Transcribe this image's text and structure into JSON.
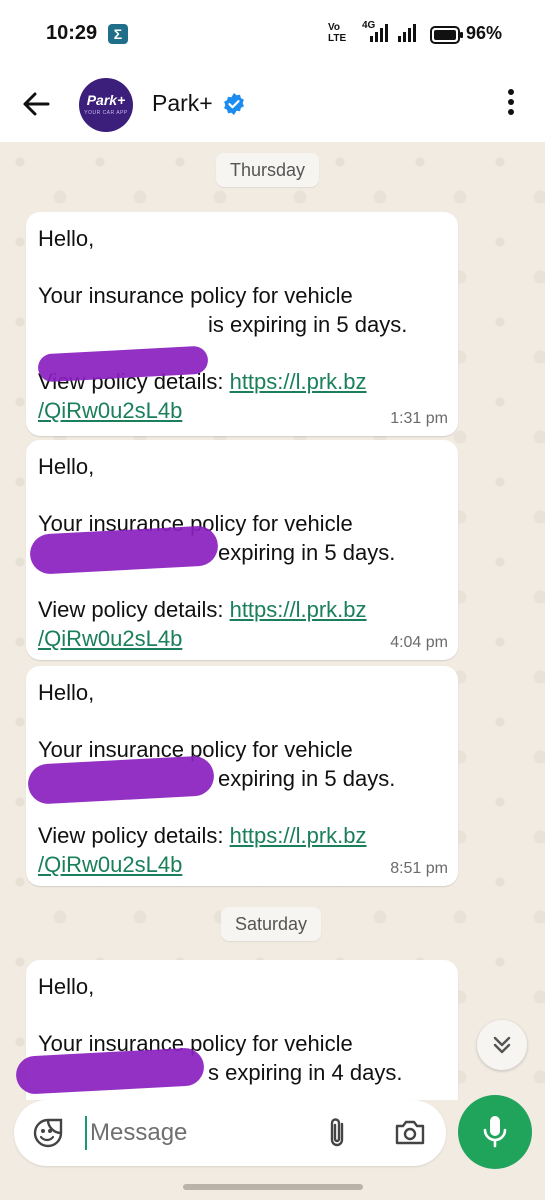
{
  "status_bar": {
    "time": "10:29",
    "app_indicator": "Σ",
    "volte": "Vo\nLTE",
    "network": "4G",
    "battery": "96%"
  },
  "header": {
    "contact_name": "Park+",
    "avatar_logo": "Park+",
    "avatar_sub": "YOUR CAR APP",
    "verified": true
  },
  "chat": {
    "day_1": "Thursday",
    "day_2": "Saturday",
    "messages": [
      {
        "greeting": "Hello,",
        "line1": "Your insurance policy for vehicle",
        "line2": "is expiring in 5 days.",
        "view_label": "View policy details: ",
        "link_part1": "https://l.prk.bz",
        "link_part2": "/QiRw0u2sL4b",
        "time": "1:31 pm"
      },
      {
        "greeting": "Hello,",
        "line1": "Your insurance policy for vehicle",
        "line2": "expiring in 5 days.",
        "view_label": "View policy details: ",
        "link_part1": "https://l.prk.bz",
        "link_part2": "/QiRw0u2sL4b",
        "time": "4:04 pm"
      },
      {
        "greeting": "Hello,",
        "line1": "Your insurance policy for vehicle",
        "line2": "expiring in 5 days.",
        "view_label": "View policy details: ",
        "link_part1": "https://l.prk.bz",
        "link_part2": "/QiRw0u2sL4b",
        "time": "8:51 pm"
      },
      {
        "greeting": "Hello,",
        "line1": "Your insurance policy for vehicle",
        "line2": "s expiring in 4 days."
      }
    ]
  },
  "input": {
    "placeholder": "Message"
  },
  "colors": {
    "accent_green": "#20a35a",
    "link_green": "#1a7f5a",
    "redaction_purple": "#8a1fbf",
    "verified_blue": "#1d8cf0"
  },
  "icons": [
    "back-arrow-icon",
    "verified-icon",
    "more-vert-icon",
    "scroll-down-icon",
    "sticker-icon",
    "attach-icon",
    "camera-icon",
    "mic-icon"
  ]
}
